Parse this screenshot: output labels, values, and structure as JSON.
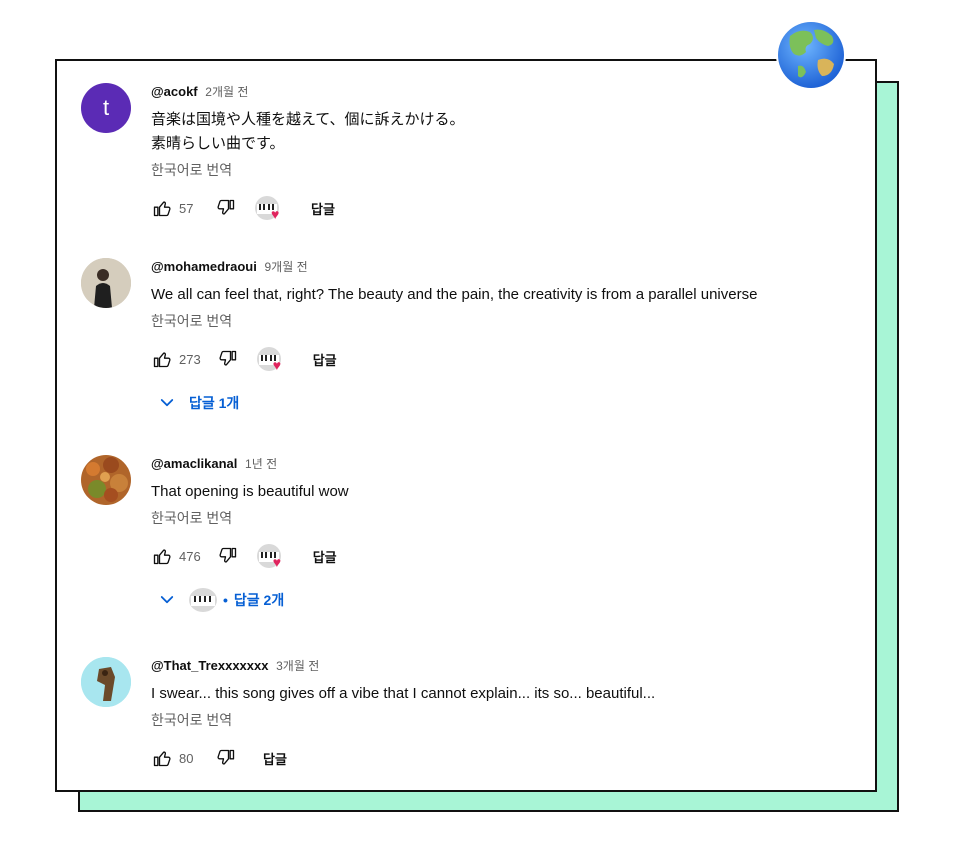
{
  "comments": [
    {
      "avatar_letter": "t",
      "handle": "@acokf",
      "time": "2개월 전",
      "lines": [
        "音楽は国境や人種を越えて、個に訴えかける。",
        "素晴らしい曲です。"
      ],
      "translate": "한국어로 번역",
      "likes": "57",
      "reply": "답글"
    },
    {
      "handle": "@mohamedraoui",
      "time": "9개월 전",
      "lines": [
        "We all can feel that, right? The beauty and the pain, the creativity is from a parallel universe"
      ],
      "translate": "한국어로 번역",
      "likes": "273",
      "reply": "답글",
      "replies_label": "답글 1개"
    },
    {
      "handle": "@amaclikanal",
      "time": "1년 전",
      "lines": [
        "That opening is beautiful wow"
      ],
      "translate": "한국어로 번역",
      "likes": "476",
      "reply": "답글",
      "replies_label": "답글 2개",
      "replies_dot": "•"
    },
    {
      "handle": "@That_Trexxxxxxx",
      "time": "3개월 전",
      "lines": [
        "I swear... this song gives off a vibe that I cannot explain... its so... beautiful..."
      ],
      "translate": "한국어로 번역",
      "likes": "80",
      "reply": "답글"
    }
  ],
  "icons": {
    "like": "thumb-up-icon",
    "dislike": "thumb-down-icon",
    "expand": "chevron-down-icon",
    "globe": "globe-icon",
    "heart": "heart-icon"
  },
  "colors": {
    "accent_blue": "#065fd4",
    "shadow_mint": "#a8f5d6",
    "heart_red": "#e0245e",
    "avatar_purple": "#5b2bb5"
  }
}
